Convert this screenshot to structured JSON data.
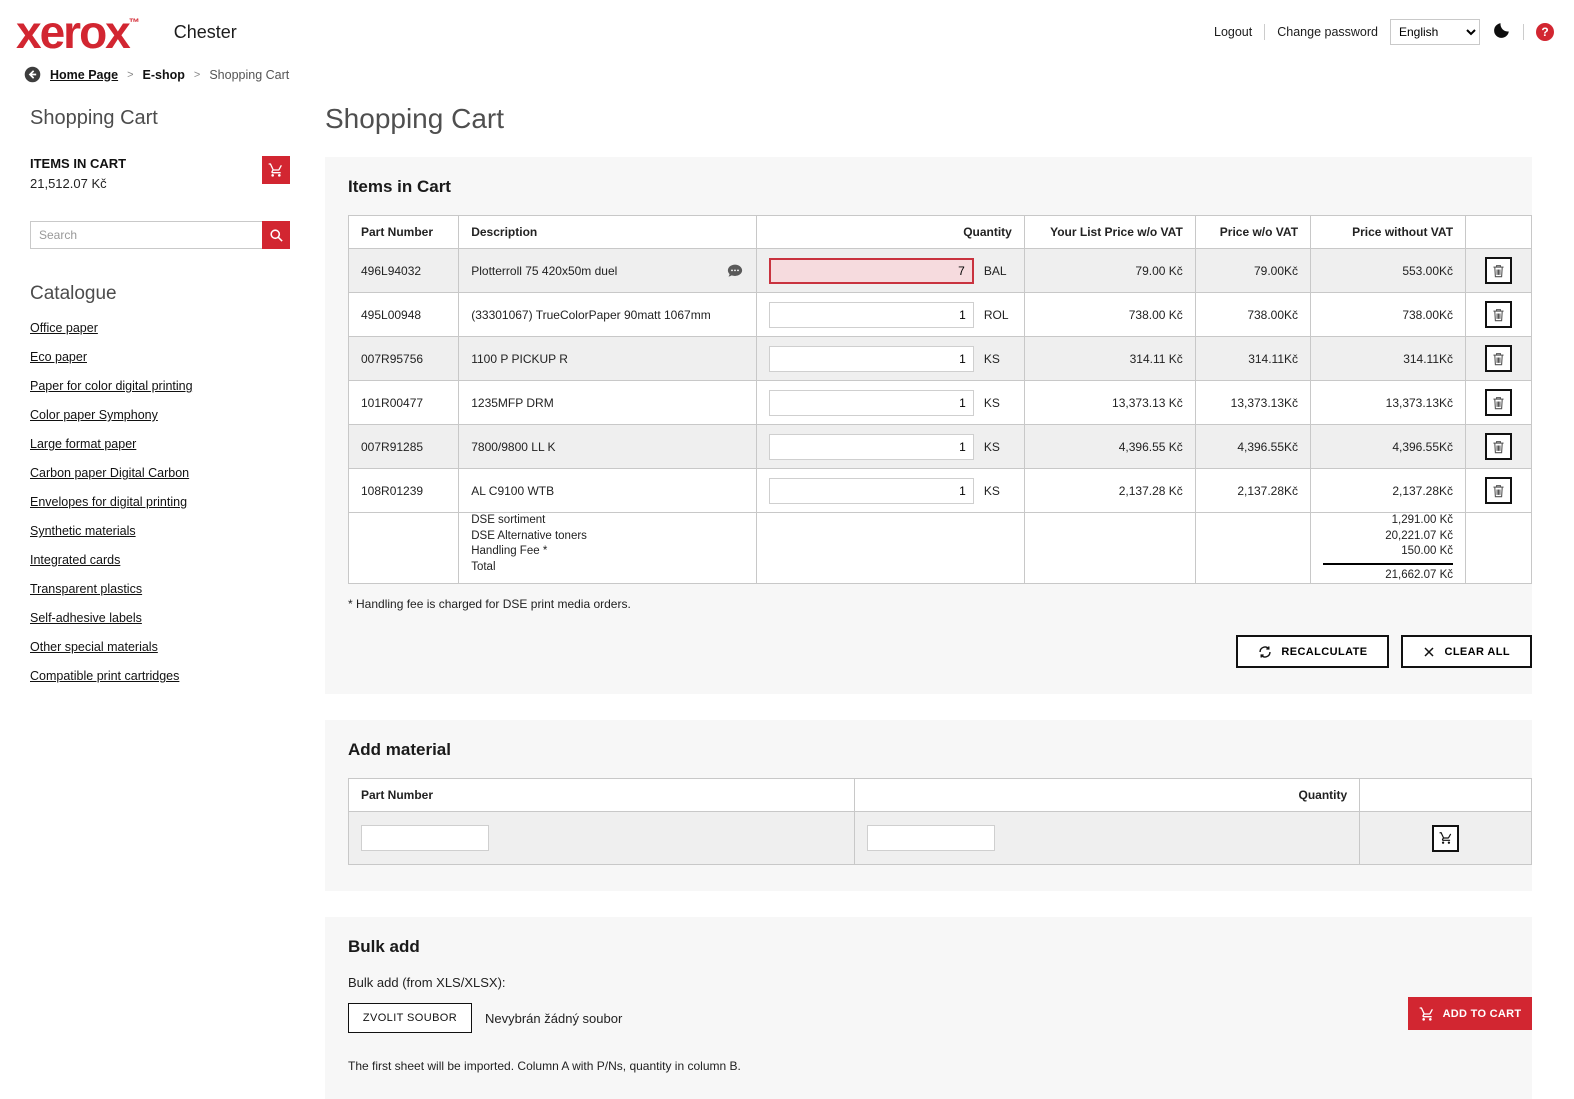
{
  "header": {
    "brand": "xerox",
    "brand_tm": "™",
    "account_name": "Chester",
    "logout_label": "Logout",
    "change_password_label": "Change password",
    "language": "English",
    "accent_color": "#d22631"
  },
  "breadcrumb": {
    "items": [
      "Home Page",
      "E-shop",
      "Shopping Cart"
    ],
    "separator": ">"
  },
  "sidebar": {
    "title": "Shopping Cart",
    "items_in_cart_label": "ITEMS IN CART",
    "items_in_cart_value": "21,512.07 Kč",
    "search_placeholder": "Search",
    "catalogue_title": "Catalogue",
    "links": [
      "Office paper",
      "Eco paper",
      "Paper for color digital printing",
      "Color paper Symphony",
      "Large format paper",
      "Carbon paper Digital Carbon",
      "Envelopes for digital printing",
      "Synthetic materials",
      "Integrated cards",
      "Transparent plastics",
      "Self-adhesive labels",
      "Other special materials",
      "Compatible print cartridges"
    ]
  },
  "main": {
    "title": "Shopping Cart",
    "items_in_cart": {
      "heading": "Items in Cart",
      "columns": {
        "part": "Part Number",
        "desc": "Description",
        "qty": "Quantity",
        "list_price": "Your List Price w/o VAT",
        "price": "Price w/o VAT",
        "price_total": "Price without VAT"
      },
      "rows": [
        {
          "part": "496L94032",
          "desc": "Plotterroll 75 420x50m duel",
          "has_comment": true,
          "qty": "7",
          "qty_error": true,
          "unit": "BAL",
          "list_price": "79.00 Kč",
          "price": "79.00Kč",
          "price_total": "553.00Kč"
        },
        {
          "part": "495L00948",
          "desc": "(33301067) TrueColorPaper 90matt 1067mm",
          "has_comment": false,
          "qty": "1",
          "qty_error": false,
          "unit": "ROL",
          "list_price": "738.00 Kč",
          "price": "738.00Kč",
          "price_total": "738.00Kč"
        },
        {
          "part": "007R95756",
          "desc": "1100 P PICKUP R",
          "has_comment": false,
          "qty": "1",
          "qty_error": false,
          "unit": "KS",
          "list_price": "314.11 Kč",
          "price": "314.11Kč",
          "price_total": "314.11Kč"
        },
        {
          "part": "101R00477",
          "desc": "1235MFP DRM",
          "has_comment": false,
          "qty": "1",
          "qty_error": false,
          "unit": "KS",
          "list_price": "13,373.13 Kč",
          "price": "13,373.13Kč",
          "price_total": "13,373.13Kč"
        },
        {
          "part": "007R91285",
          "desc": "7800/9800 LL K",
          "has_comment": false,
          "qty": "1",
          "qty_error": false,
          "unit": "KS",
          "list_price": "4,396.55 Kč",
          "price": "4,396.55Kč",
          "price_total": "4,396.55Kč"
        },
        {
          "part": "108R01239",
          "desc": "AL C9100 WTB",
          "has_comment": false,
          "qty": "1",
          "qty_error": false,
          "unit": "KS",
          "list_price": "2,137.28 Kč",
          "price": "2,137.28Kč",
          "price_total": "2,137.28Kč"
        }
      ],
      "summary": {
        "labels": [
          "DSE sortiment",
          "DSE Alternative toners",
          "Handling Fee *",
          "Total"
        ],
        "values": [
          "1,291.00 Kč",
          "20,221.07 Kč",
          "150.00 Kč",
          "21,662.07 Kč"
        ]
      },
      "footnote": "* Handling fee is charged for DSE print media orders.",
      "recalculate_label": "RECALCULATE",
      "clear_all_label": "CLEAR ALL"
    },
    "add_material": {
      "heading": "Add material",
      "columns": {
        "part": "Part Number",
        "qty": "Quantity"
      }
    },
    "bulk_add": {
      "heading": "Bulk add",
      "label": "Bulk add (from XLS/XLSX):",
      "choose_file_label": "ZVOLIT SOUBOR",
      "no_file_text": "Nevybrán žádný soubor",
      "note": "The first sheet will be imported. Column A with P/Ns, quantity in column B.",
      "add_to_cart_label": "ADD TO CART"
    }
  }
}
